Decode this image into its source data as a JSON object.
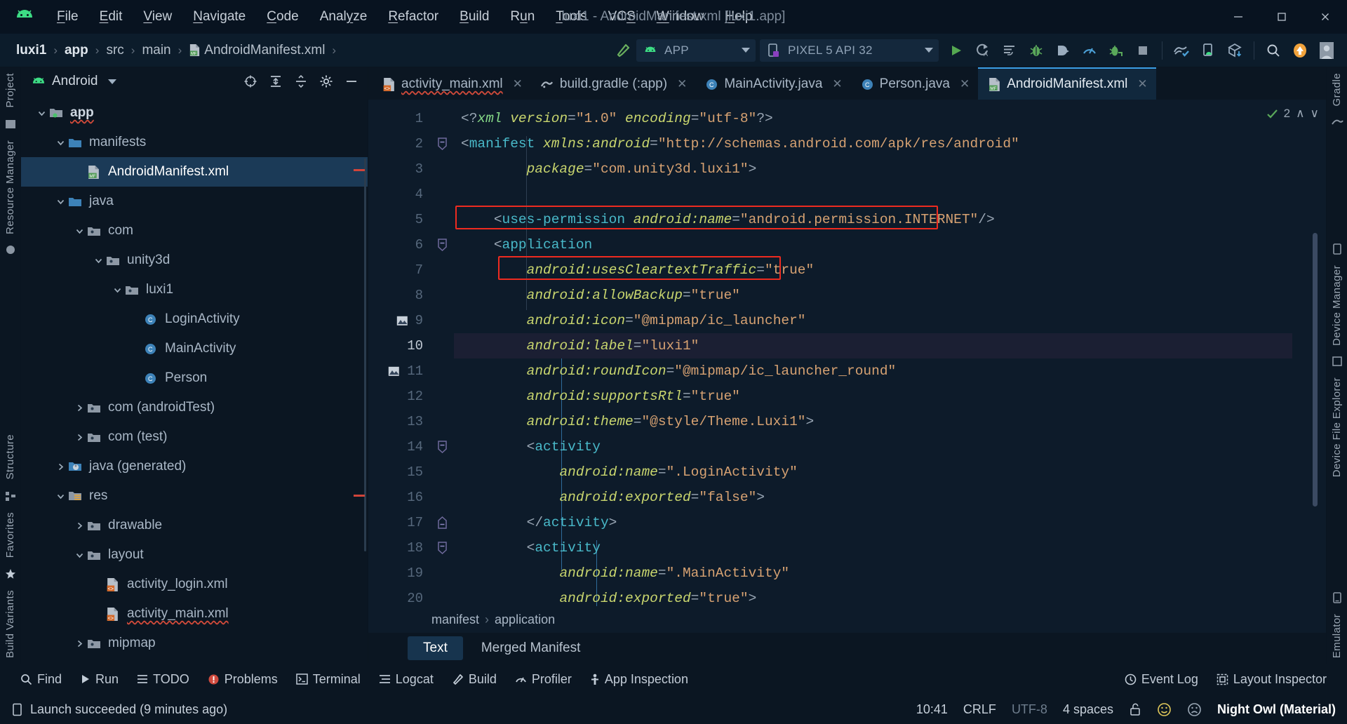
{
  "window": {
    "title": "luxi1 - AndroidManifest.xml [luxi1.app]",
    "minimize": "—",
    "maximize": "▢",
    "close": "✕"
  },
  "menubar": {
    "logo_icon": "android-logo-icon",
    "items": [
      {
        "label": "File",
        "mnemonic": "F"
      },
      {
        "label": "Edit",
        "mnemonic": "E"
      },
      {
        "label": "View",
        "mnemonic": "V"
      },
      {
        "label": "Navigate",
        "mnemonic": "N"
      },
      {
        "label": "Code",
        "mnemonic": "C"
      },
      {
        "label": "Analyze",
        "mnemonic": "y"
      },
      {
        "label": "Refactor",
        "mnemonic": "R"
      },
      {
        "label": "Build",
        "mnemonic": "B"
      },
      {
        "label": "Run",
        "mnemonic": "u"
      },
      {
        "label": "Tools",
        "mnemonic": "T"
      },
      {
        "label": "VCS",
        "mnemonic": "S"
      },
      {
        "label": "Window",
        "mnemonic": "W"
      },
      {
        "label": "Help",
        "mnemonic": "H"
      }
    ]
  },
  "navbar": {
    "breadcrumbs": [
      {
        "label": "luxi1",
        "bold": true,
        "icon": null
      },
      {
        "label": "app",
        "bold": true,
        "icon": null
      },
      {
        "label": "src",
        "bold": false,
        "icon": null
      },
      {
        "label": "main",
        "bold": false,
        "icon": null
      },
      {
        "label": "AndroidManifest.xml",
        "bold": false,
        "icon": "manifest-file-icon"
      }
    ],
    "separator": "›",
    "run_config": {
      "label": "APP",
      "icon": "android-app-icon"
    },
    "device": {
      "label": "PIXEL 5 API 32",
      "icon": "device-icon"
    },
    "buttons": [
      {
        "name": "build-hammer-button",
        "icon": "hammer-icon"
      },
      {
        "name": "run-button",
        "icon": "play-icon"
      },
      {
        "name": "apply-changes-button",
        "icon": "apply-changes-icon"
      },
      {
        "name": "apply-code-changes-button",
        "icon": "apply-code-changes-icon"
      },
      {
        "name": "debug-button",
        "icon": "bug-icon"
      },
      {
        "name": "run-with-coverage-button",
        "icon": "coverage-icon"
      },
      {
        "name": "profiler-button",
        "icon": "profiler-icon"
      },
      {
        "name": "attach-debugger-button",
        "icon": "attach-debugger-icon"
      },
      {
        "name": "stop-button",
        "icon": "stop-square-icon"
      },
      {
        "name": "sync-gradle-button",
        "icon": "gradle-sync-icon"
      },
      {
        "name": "avd-manager-button",
        "icon": "avd-manager-icon"
      },
      {
        "name": "sdk-manager-button",
        "icon": "sdk-manager-icon"
      },
      {
        "name": "search-everywhere-button",
        "icon": "search-icon"
      },
      {
        "name": "update-button",
        "icon": "update-arrow-icon"
      },
      {
        "name": "account-button",
        "icon": "avatar-icon"
      }
    ]
  },
  "left_rail": {
    "top": [
      "Project"
    ],
    "middle": [
      "Resource Manager"
    ],
    "bottom": [
      "Structure",
      "Favorites",
      "Build Variants"
    ]
  },
  "right_rail": {
    "top": [
      "Gradle"
    ],
    "middle": [
      "Device Manager",
      "Device File Explorer"
    ],
    "bottom": [
      "Emulator"
    ]
  },
  "project_panel": {
    "title": "Android",
    "title_icon": "android-head-icon",
    "actions": [
      {
        "name": "select-opened-file-button",
        "icon": "crosshair-icon"
      },
      {
        "name": "expand-all-button",
        "icon": "expand-all-icon"
      },
      {
        "name": "collapse-all-button",
        "icon": "collapse-all-icon"
      },
      {
        "name": "settings-button",
        "icon": "gear-icon"
      },
      {
        "name": "hide-panel-button",
        "icon": "minus-icon"
      }
    ],
    "tree": [
      {
        "label": "app",
        "depth": 0,
        "arrow": "down",
        "icon": "module-folder-icon",
        "bold": true,
        "selected": false,
        "error": true
      },
      {
        "label": "manifests",
        "depth": 1,
        "arrow": "down",
        "icon": "folder-blue-icon",
        "bold": false,
        "selected": false,
        "error": false
      },
      {
        "label": "AndroidManifest.xml",
        "depth": 2,
        "arrow": "none",
        "icon": "manifest-file-icon",
        "bold": false,
        "selected": true,
        "error": false
      },
      {
        "label": "java",
        "depth": 1,
        "arrow": "down",
        "icon": "folder-blue-icon",
        "bold": false,
        "selected": false,
        "error": false
      },
      {
        "label": "com",
        "depth": 2,
        "arrow": "down",
        "icon": "package-icon",
        "bold": false,
        "selected": false,
        "error": false
      },
      {
        "label": "unity3d",
        "depth": 3,
        "arrow": "down",
        "icon": "package-icon",
        "bold": false,
        "selected": false,
        "error": false
      },
      {
        "label": "luxi1",
        "depth": 4,
        "arrow": "down",
        "icon": "package-icon",
        "bold": false,
        "selected": false,
        "error": false
      },
      {
        "label": "LoginActivity",
        "depth": 5,
        "arrow": "none",
        "icon": "java-class-icon",
        "bold": false,
        "selected": false,
        "error": false
      },
      {
        "label": "MainActivity",
        "depth": 5,
        "arrow": "none",
        "icon": "java-class-icon",
        "bold": false,
        "selected": false,
        "error": false
      },
      {
        "label": "Person",
        "depth": 5,
        "arrow": "none",
        "icon": "java-class-icon",
        "bold": false,
        "selected": false,
        "error": false
      },
      {
        "label": "com (androidTest)",
        "depth": 2,
        "arrow": "right",
        "icon": "package-icon",
        "bold": false,
        "selected": false,
        "error": false
      },
      {
        "label": "com (test)",
        "depth": 2,
        "arrow": "right",
        "icon": "package-icon",
        "bold": false,
        "selected": false,
        "error": false
      },
      {
        "label": "java (generated)",
        "depth": 1,
        "arrow": "right",
        "icon": "generated-folder-icon",
        "bold": false,
        "selected": false,
        "error": false
      },
      {
        "label": "res",
        "depth": 1,
        "arrow": "down",
        "icon": "res-folder-icon",
        "bold": false,
        "selected": false,
        "error": false
      },
      {
        "label": "drawable",
        "depth": 2,
        "arrow": "right",
        "icon": "package-icon",
        "bold": false,
        "selected": false,
        "error": false
      },
      {
        "label": "layout",
        "depth": 2,
        "arrow": "down",
        "icon": "package-icon",
        "bold": false,
        "selected": false,
        "error": false
      },
      {
        "label": "activity_login.xml",
        "depth": 3,
        "arrow": "none",
        "icon": "layout-file-icon",
        "bold": false,
        "selected": false,
        "error": false
      },
      {
        "label": "activity_main.xml",
        "depth": 3,
        "arrow": "none",
        "icon": "layout-file-icon",
        "bold": false,
        "selected": false,
        "error": true
      },
      {
        "label": "mipmap",
        "depth": 2,
        "arrow": "right",
        "icon": "package-icon",
        "bold": false,
        "selected": false,
        "error": false
      }
    ]
  },
  "editor": {
    "tabs": [
      {
        "label": "activity_main.xml",
        "icon": "layout-file-icon",
        "active": false,
        "closable": true,
        "error": true
      },
      {
        "label": "build.gradle (:app)",
        "icon": "gradle-icon",
        "active": false,
        "closable": true,
        "error": false
      },
      {
        "label": "MainActivity.java",
        "icon": "java-class-icon",
        "active": false,
        "closable": true,
        "error": false
      },
      {
        "label": "Person.java",
        "icon": "java-class-icon",
        "active": false,
        "closable": true,
        "error": false
      },
      {
        "label": "AndroidManifest.xml",
        "icon": "manifest-file-icon",
        "active": true,
        "closable": true,
        "error": false
      }
    ],
    "inspection": {
      "count": "2",
      "icon": "check-ok-icon",
      "up": "∧",
      "down": "∨"
    },
    "current_line": 10,
    "lines": [
      {
        "n": 1,
        "fold": "none",
        "gutter_icon": null,
        "tokens": [
          {
            "t": "<?",
            "c": "punct"
          },
          {
            "t": "xml",
            "c": "pi"
          },
          {
            "t": " version",
            "c": "attri"
          },
          {
            "t": "=",
            "c": "eq"
          },
          {
            "t": "\"1.0\"",
            "c": "str"
          },
          {
            "t": " encoding",
            "c": "attri"
          },
          {
            "t": "=",
            "c": "eq"
          },
          {
            "t": "\"utf-8\"",
            "c": "str"
          },
          {
            "t": "?>",
            "c": "punct"
          }
        ],
        "indent": 0
      },
      {
        "n": 2,
        "fold": "start",
        "gutter_icon": null,
        "tokens": [
          {
            "t": "<",
            "c": "punct"
          },
          {
            "t": "manifest",
            "c": "tag"
          },
          {
            "t": " ",
            "c": "punct"
          },
          {
            "t": "xmlns:android",
            "c": "attri"
          },
          {
            "t": "=",
            "c": "eq"
          },
          {
            "t": "\"http://schemas.android.com/apk/res/android\"",
            "c": "str"
          }
        ],
        "indent": 0
      },
      {
        "n": 3,
        "fold": "none",
        "gutter_icon": null,
        "tokens": [
          {
            "t": "    ",
            "c": "punct"
          },
          {
            "t": "package",
            "c": "attri"
          },
          {
            "t": "=",
            "c": "eq"
          },
          {
            "t": "\"com.unity3d.luxi1\"",
            "c": "str"
          },
          {
            "t": ">",
            "c": "punct"
          }
        ],
        "indent": 1
      },
      {
        "n": 4,
        "fold": "none",
        "gutter_icon": null,
        "tokens": [],
        "indent": 0
      },
      {
        "n": 5,
        "fold": "none",
        "gutter_icon": null,
        "highlight": true,
        "tokens": [
          {
            "t": "<",
            "c": "punct"
          },
          {
            "t": "uses-permission",
            "c": "tag"
          },
          {
            "t": " ",
            "c": "punct"
          },
          {
            "t": "android:name",
            "c": "attri"
          },
          {
            "t": "=",
            "c": "eq"
          },
          {
            "t": "\"android.permission.INTERNET\"",
            "c": "str"
          },
          {
            "t": "/>",
            "c": "punct"
          }
        ],
        "indent": 1
      },
      {
        "n": 6,
        "fold": "start",
        "gutter_icon": null,
        "tokens": [
          {
            "t": "<",
            "c": "punct"
          },
          {
            "t": "application",
            "c": "tag"
          }
        ],
        "indent": 1
      },
      {
        "n": 7,
        "fold": "none",
        "gutter_icon": null,
        "highlight2": true,
        "tokens": [
          {
            "t": "android:usesCleartextTraffic",
            "c": "attri"
          },
          {
            "t": "=",
            "c": "eq"
          },
          {
            "t": "\"true\"",
            "c": "str"
          }
        ],
        "indent": 2
      },
      {
        "n": 8,
        "fold": "none",
        "gutter_icon": null,
        "tokens": [
          {
            "t": "android:allowBackup",
            "c": "attri"
          },
          {
            "t": "=",
            "c": "eq"
          },
          {
            "t": "\"true\"",
            "c": "str"
          }
        ],
        "indent": 2
      },
      {
        "n": 9,
        "fold": "none",
        "gutter_icon": "image-preview-icon",
        "tokens": [
          {
            "t": "android:icon",
            "c": "attri"
          },
          {
            "t": "=",
            "c": "eq"
          },
          {
            "t": "\"@mipmap/ic_launcher\"",
            "c": "str"
          }
        ],
        "indent": 2
      },
      {
        "n": 10,
        "fold": "none",
        "gutter_icon": null,
        "tokens": [
          {
            "t": "android:label",
            "c": "attri"
          },
          {
            "t": "=",
            "c": "eq"
          },
          {
            "t": "\"luxi1\"",
            "c": "str"
          }
        ],
        "indent": 2
      },
      {
        "n": 11,
        "fold": "none",
        "gutter_icon": "image-preview-icon",
        "tokens": [
          {
            "t": "android:roundIcon",
            "c": "attri"
          },
          {
            "t": "=",
            "c": "eq"
          },
          {
            "t": "\"@mipmap/ic_launcher_round\"",
            "c": "str"
          }
        ],
        "indent": 2
      },
      {
        "n": 12,
        "fold": "none",
        "gutter_icon": null,
        "tokens": [
          {
            "t": "android:supportsRtl",
            "c": "attri"
          },
          {
            "t": "=",
            "c": "eq"
          },
          {
            "t": "\"true\"",
            "c": "str"
          }
        ],
        "indent": 2
      },
      {
        "n": 13,
        "fold": "none",
        "gutter_icon": null,
        "tokens": [
          {
            "t": "android:theme",
            "c": "attri"
          },
          {
            "t": "=",
            "c": "eq"
          },
          {
            "t": "\"@style/Theme.Luxi1\"",
            "c": "str"
          },
          {
            "t": ">",
            "c": "punct"
          }
        ],
        "indent": 2
      },
      {
        "n": 14,
        "fold": "start",
        "gutter_icon": null,
        "tokens": [
          {
            "t": "<",
            "c": "punct"
          },
          {
            "t": "activity",
            "c": "tag"
          }
        ],
        "indent": 2
      },
      {
        "n": 15,
        "fold": "none",
        "gutter_icon": null,
        "tokens": [
          {
            "t": "android:name",
            "c": "attri"
          },
          {
            "t": "=",
            "c": "eq"
          },
          {
            "t": "\".LoginActivity\"",
            "c": "str"
          }
        ],
        "indent": 3
      },
      {
        "n": 16,
        "fold": "none",
        "gutter_icon": null,
        "tokens": [
          {
            "t": "android:exported",
            "c": "attri"
          },
          {
            "t": "=",
            "c": "eq"
          },
          {
            "t": "\"false\"",
            "c": "str"
          },
          {
            "t": ">",
            "c": "punct"
          }
        ],
        "indent": 3
      },
      {
        "n": 17,
        "fold": "end",
        "gutter_icon": null,
        "tokens": [
          {
            "t": "</",
            "c": "punct"
          },
          {
            "t": "activity",
            "c": "tag"
          },
          {
            "t": ">",
            "c": "punct"
          }
        ],
        "indent": 2
      },
      {
        "n": 18,
        "fold": "start",
        "gutter_icon": null,
        "tokens": [
          {
            "t": "<",
            "c": "punct"
          },
          {
            "t": "activity",
            "c": "tag"
          }
        ],
        "indent": 2
      },
      {
        "n": 19,
        "fold": "none",
        "gutter_icon": null,
        "tokens": [
          {
            "t": "android:name",
            "c": "attri"
          },
          {
            "t": "=",
            "c": "eq"
          },
          {
            "t": "\".MainActivity\"",
            "c": "str"
          }
        ],
        "indent": 3
      },
      {
        "n": 20,
        "fold": "none",
        "gutter_icon": null,
        "tokens": [
          {
            "t": "android:exported",
            "c": "attri"
          },
          {
            "t": "=",
            "c": "eq"
          },
          {
            "t": "\"true\"",
            "c": "str"
          },
          {
            "t": ">",
            "c": "punct"
          }
        ],
        "indent": 3
      }
    ],
    "breadcrumb": [
      "manifest",
      "application"
    ],
    "breadcrumb_sep": "›",
    "view_tabs": [
      {
        "label": "Text",
        "active": true
      },
      {
        "label": "Merged Manifest",
        "active": false
      }
    ]
  },
  "toolwindow_bar": {
    "left": [
      {
        "label": "Find",
        "icon": "search-icon"
      },
      {
        "label": "Run",
        "icon": "play-icon"
      },
      {
        "label": "TODO",
        "icon": "todo-list-icon"
      },
      {
        "label": "Problems",
        "icon": "problems-error-icon"
      },
      {
        "label": "Terminal",
        "icon": "terminal-icon"
      },
      {
        "label": "Logcat",
        "icon": "logcat-icon"
      },
      {
        "label": "Build",
        "icon": "hammer-icon"
      },
      {
        "label": "Profiler",
        "icon": "profiler-icon"
      },
      {
        "label": "App Inspection",
        "icon": "app-inspection-icon"
      }
    ],
    "right": [
      {
        "label": "Event Log",
        "icon": "event-log-icon"
      },
      {
        "label": "Layout Inspector",
        "icon": "layout-inspector-icon"
      }
    ]
  },
  "statusbar": {
    "message": "Launch succeeded (9 minutes ago)",
    "message_icon": "device-small-icon",
    "caret_position": "10:41",
    "line_separator": "CRLF",
    "encoding": "UTF-8",
    "indent": "4 spaces",
    "lock_icon": "unlocked-icon",
    "feedback_happy_icon": "smiley-happy-icon",
    "feedback_sad_icon": "smiley-sad-icon",
    "theme": "Night Owl (Material)"
  },
  "colors": {
    "accent_blue": "#3b9ee5",
    "selection": "#1b3a57",
    "highlight_red": "#ee2b20",
    "android_green": "#3ddc84",
    "tag_cyan": "#49b9c9",
    "attr_yellow": "#c9d66e",
    "string_orange": "#e7a967"
  }
}
